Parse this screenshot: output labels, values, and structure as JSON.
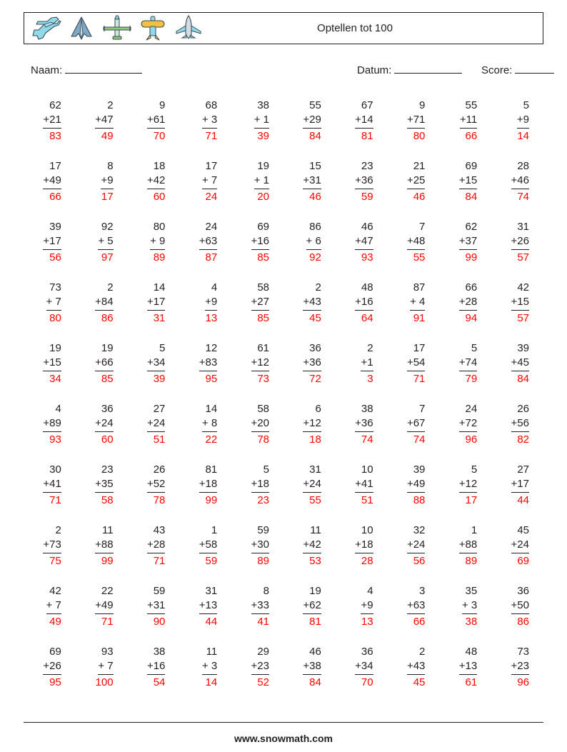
{
  "header": {
    "title": "Optellen tot 100",
    "icons": [
      "jet-fighter-icon",
      "stealth-bomber-icon",
      "propeller-plane-icon",
      "biplane-icon",
      "airliner-icon"
    ]
  },
  "meta": {
    "name_label": "Naam:",
    "date_label": "Datum:",
    "score_label": "Score:"
  },
  "footer": {
    "website": "www.snowmath.com"
  },
  "colors": {
    "answer": "#ff0000",
    "text": "#231f20",
    "border": "#231f20"
  },
  "worksheet": {
    "columns": 10,
    "rows": 10,
    "operator": "+",
    "problems": [
      {
        "top": "62",
        "bottom": "+21",
        "answer": "83"
      },
      {
        "top": "2",
        "bottom": "+47",
        "answer": "49"
      },
      {
        "top": "9",
        "bottom": "+61",
        "answer": "70"
      },
      {
        "top": "68",
        "bottom": "+ 3",
        "answer": "71"
      },
      {
        "top": "38",
        "bottom": "+ 1",
        "answer": "39"
      },
      {
        "top": "55",
        "bottom": "+29",
        "answer": "84"
      },
      {
        "top": "67",
        "bottom": "+14",
        "answer": "81"
      },
      {
        "top": "9",
        "bottom": "+71",
        "answer": "80"
      },
      {
        "top": "55",
        "bottom": "+11",
        "answer": "66"
      },
      {
        "top": "5",
        "bottom": "+9",
        "answer": "14"
      },
      {
        "top": "17",
        "bottom": "+49",
        "answer": "66"
      },
      {
        "top": "8",
        "bottom": "+9",
        "answer": "17"
      },
      {
        "top": "18",
        "bottom": "+42",
        "answer": "60"
      },
      {
        "top": "17",
        "bottom": "+ 7",
        "answer": "24"
      },
      {
        "top": "19",
        "bottom": "+ 1",
        "answer": "20"
      },
      {
        "top": "15",
        "bottom": "+31",
        "answer": "46"
      },
      {
        "top": "23",
        "bottom": "+36",
        "answer": "59"
      },
      {
        "top": "21",
        "bottom": "+25",
        "answer": "46"
      },
      {
        "top": "69",
        "bottom": "+15",
        "answer": "84"
      },
      {
        "top": "28",
        "bottom": "+46",
        "answer": "74"
      },
      {
        "top": "39",
        "bottom": "+17",
        "answer": "56"
      },
      {
        "top": "92",
        "bottom": "+ 5",
        "answer": "97"
      },
      {
        "top": "80",
        "bottom": "+ 9",
        "answer": "89"
      },
      {
        "top": "24",
        "bottom": "+63",
        "answer": "87"
      },
      {
        "top": "69",
        "bottom": "+16",
        "answer": "85"
      },
      {
        "top": "86",
        "bottom": "+ 6",
        "answer": "92"
      },
      {
        "top": "46",
        "bottom": "+47",
        "answer": "93"
      },
      {
        "top": "7",
        "bottom": "+48",
        "answer": "55"
      },
      {
        "top": "62",
        "bottom": "+37",
        "answer": "99"
      },
      {
        "top": "31",
        "bottom": "+26",
        "answer": "57"
      },
      {
        "top": "73",
        "bottom": "+ 7",
        "answer": "80"
      },
      {
        "top": "2",
        "bottom": "+84",
        "answer": "86"
      },
      {
        "top": "14",
        "bottom": "+17",
        "answer": "31"
      },
      {
        "top": "4",
        "bottom": "+9",
        "answer": "13"
      },
      {
        "top": "58",
        "bottom": "+27",
        "answer": "85"
      },
      {
        "top": "2",
        "bottom": "+43",
        "answer": "45"
      },
      {
        "top": "48",
        "bottom": "+16",
        "answer": "64"
      },
      {
        "top": "87",
        "bottom": "+ 4",
        "answer": "91"
      },
      {
        "top": "66",
        "bottom": "+28",
        "answer": "94"
      },
      {
        "top": "42",
        "bottom": "+15",
        "answer": "57"
      },
      {
        "top": "19",
        "bottom": "+15",
        "answer": "34"
      },
      {
        "top": "19",
        "bottom": "+66",
        "answer": "85"
      },
      {
        "top": "5",
        "bottom": "+34",
        "answer": "39"
      },
      {
        "top": "12",
        "bottom": "+83",
        "answer": "95"
      },
      {
        "top": "61",
        "bottom": "+12",
        "answer": "73"
      },
      {
        "top": "36",
        "bottom": "+36",
        "answer": "72"
      },
      {
        "top": "2",
        "bottom": "+1",
        "answer": "3"
      },
      {
        "top": "17",
        "bottom": "+54",
        "answer": "71"
      },
      {
        "top": "5",
        "bottom": "+74",
        "answer": "79"
      },
      {
        "top": "39",
        "bottom": "+45",
        "answer": "84"
      },
      {
        "top": "4",
        "bottom": "+89",
        "answer": "93"
      },
      {
        "top": "36",
        "bottom": "+24",
        "answer": "60"
      },
      {
        "top": "27",
        "bottom": "+24",
        "answer": "51"
      },
      {
        "top": "14",
        "bottom": "+ 8",
        "answer": "22"
      },
      {
        "top": "58",
        "bottom": "+20",
        "answer": "78"
      },
      {
        "top": "6",
        "bottom": "+12",
        "answer": "18"
      },
      {
        "top": "38",
        "bottom": "+36",
        "answer": "74"
      },
      {
        "top": "7",
        "bottom": "+67",
        "answer": "74"
      },
      {
        "top": "24",
        "bottom": "+72",
        "answer": "96"
      },
      {
        "top": "26",
        "bottom": "+56",
        "answer": "82"
      },
      {
        "top": "30",
        "bottom": "+41",
        "answer": "71"
      },
      {
        "top": "23",
        "bottom": "+35",
        "answer": "58"
      },
      {
        "top": "26",
        "bottom": "+52",
        "answer": "78"
      },
      {
        "top": "81",
        "bottom": "+18",
        "answer": "99"
      },
      {
        "top": "5",
        "bottom": "+18",
        "answer": "23"
      },
      {
        "top": "31",
        "bottom": "+24",
        "answer": "55"
      },
      {
        "top": "10",
        "bottom": "+41",
        "answer": "51"
      },
      {
        "top": "39",
        "bottom": "+49",
        "answer": "88"
      },
      {
        "top": "5",
        "bottom": "+12",
        "answer": "17"
      },
      {
        "top": "27",
        "bottom": "+17",
        "answer": "44"
      },
      {
        "top": "2",
        "bottom": "+73",
        "answer": "75"
      },
      {
        "top": "11",
        "bottom": "+88",
        "answer": "99"
      },
      {
        "top": "43",
        "bottom": "+28",
        "answer": "71"
      },
      {
        "top": "1",
        "bottom": "+58",
        "answer": "59"
      },
      {
        "top": "59",
        "bottom": "+30",
        "answer": "89"
      },
      {
        "top": "11",
        "bottom": "+42",
        "answer": "53"
      },
      {
        "top": "10",
        "bottom": "+18",
        "answer": "28"
      },
      {
        "top": "32",
        "bottom": "+24",
        "answer": "56"
      },
      {
        "top": "1",
        "bottom": "+88",
        "answer": "89"
      },
      {
        "top": "45",
        "bottom": "+24",
        "answer": "69"
      },
      {
        "top": "42",
        "bottom": "+ 7",
        "answer": "49"
      },
      {
        "top": "22",
        "bottom": "+49",
        "answer": "71"
      },
      {
        "top": "59",
        "bottom": "+31",
        "answer": "90"
      },
      {
        "top": "31",
        "bottom": "+13",
        "answer": "44"
      },
      {
        "top": "8",
        "bottom": "+33",
        "answer": "41"
      },
      {
        "top": "19",
        "bottom": "+62",
        "answer": "81"
      },
      {
        "top": "4",
        "bottom": "+9",
        "answer": "13"
      },
      {
        "top": "3",
        "bottom": "+63",
        "answer": "66"
      },
      {
        "top": "35",
        "bottom": "+ 3",
        "answer": "38"
      },
      {
        "top": "36",
        "bottom": "+50",
        "answer": "86"
      },
      {
        "top": "69",
        "bottom": "+26",
        "answer": "95"
      },
      {
        "top": "93",
        "bottom": "+ 7",
        "answer": "100"
      },
      {
        "top": "38",
        "bottom": "+16",
        "answer": "54"
      },
      {
        "top": "11",
        "bottom": "+ 3",
        "answer": "14"
      },
      {
        "top": "29",
        "bottom": "+23",
        "answer": "52"
      },
      {
        "top": "46",
        "bottom": "+38",
        "answer": "84"
      },
      {
        "top": "36",
        "bottom": "+34",
        "answer": "70"
      },
      {
        "top": "2",
        "bottom": "+43",
        "answer": "45"
      },
      {
        "top": "48",
        "bottom": "+13",
        "answer": "61"
      },
      {
        "top": "73",
        "bottom": "+23",
        "answer": "96"
      }
    ]
  }
}
